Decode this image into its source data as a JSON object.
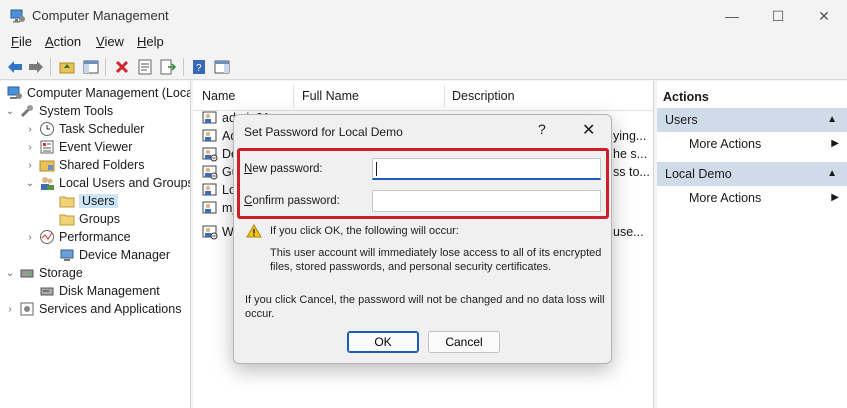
{
  "window": {
    "title": "Computer Management",
    "controls": {
      "minimize": "—",
      "maximize": "☐",
      "close": "✕"
    }
  },
  "menu": [
    {
      "label": "File",
      "ul": "F",
      "rest": "ile"
    },
    {
      "label": "Action",
      "ul": "A",
      "rest": "ction"
    },
    {
      "label": "View",
      "ul": "V",
      "rest": "iew"
    },
    {
      "label": "Help",
      "ul": "H",
      "rest": "elp"
    }
  ],
  "tree": {
    "root": "Computer Management (Local",
    "system_tools": "System Tools",
    "task_scheduler": "Task Scheduler",
    "event_viewer": "Event Viewer",
    "shared_folders": "Shared Folders",
    "local_users_groups": "Local Users and Groups",
    "users": "Users",
    "groups": "Groups",
    "performance": "Performance",
    "device_manager": "Device Manager",
    "storage": "Storage",
    "disk_management": "Disk Management",
    "services_apps": "Services and Applications"
  },
  "list": {
    "columns": {
      "name": "Name",
      "full_name": "Full Name",
      "description": "Description"
    },
    "rows": [
      {
        "name": "admin01",
        "full": "",
        "desc": ""
      },
      {
        "name": "Ad",
        "full": "",
        "desc": "ying..."
      },
      {
        "name": "Def",
        "full": "",
        "desc": "he s..."
      },
      {
        "name": "Gu",
        "full": "",
        "desc": "ss to..."
      },
      {
        "name": "Loc",
        "full": "",
        "desc": ""
      },
      {
        "name": "m_",
        "full": "",
        "desc": ""
      },
      {
        "name": "WD",
        "full": "",
        "desc": "use..."
      }
    ]
  },
  "actions": {
    "title": "Actions",
    "sections": [
      {
        "label": "Users",
        "item": "More Actions"
      },
      {
        "label": "Local Demo",
        "item": "More Actions"
      }
    ]
  },
  "dialog": {
    "title": "Set Password for Local Demo",
    "help": "?",
    "close": "✕",
    "new_password_ul": "N",
    "new_password_rest": "ew password:",
    "confirm_password_ul": "C",
    "confirm_password_rest": "onfirm password:",
    "new_password_value": "",
    "confirm_password_value": "",
    "warning_heading": "If you click OK, the following will occur:",
    "warning_line1": "This user account will immediately lose access to all of its encrypted",
    "warning_line2": "files, stored passwords, and personal security certificates.",
    "cancel_line1": "If you click Cancel, the password will not be changed and no data loss will",
    "cancel_line2": "occur.",
    "ok_label": "OK",
    "cancel_label": "Cancel"
  },
  "colors": {
    "highlight": "#cc1f2a",
    "accent": "#1a5fb4",
    "action_section": "#cfdbe8",
    "selection": "#cce4f7"
  }
}
